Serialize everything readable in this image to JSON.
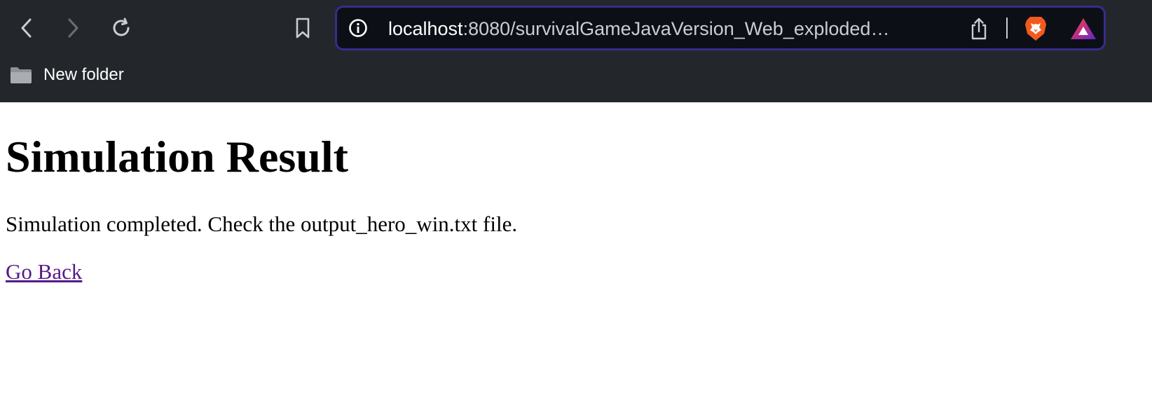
{
  "browser": {
    "nav": {
      "back_icon": "chevron-left-icon",
      "forward_icon": "chevron-right-icon",
      "reload_icon": "reload-icon",
      "bookmark_icon": "bookmark-icon"
    },
    "address_bar": {
      "host": "localhost",
      "rest": ":8080/survivalGameJavaVersion_Web_exploded/si...",
      "info_icon": "info-icon",
      "share_icon": "share-icon",
      "brave_shields_icon": "brave-lion-icon",
      "rewards_icon": "brave-rewards-triangle-icon",
      "border_color": "#352e8a",
      "background_color": "#0d0f17"
    },
    "bookmarks_bar": {
      "items": [
        {
          "label": "New folder",
          "icon": "folder-icon"
        }
      ]
    },
    "chrome_color": "#23272c"
  },
  "page": {
    "title": "Simulation Result",
    "message": "Simulation completed. Check the output_hero_win.txt file.",
    "link_label": "Go Back",
    "link_color": "#551a8b"
  }
}
